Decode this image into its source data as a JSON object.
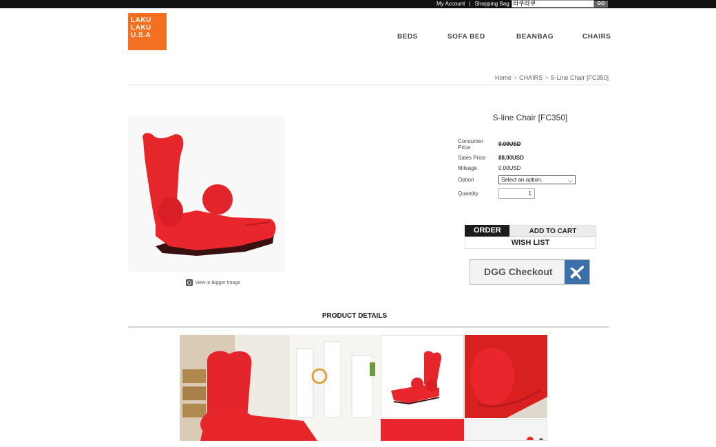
{
  "topbar": {
    "my_account": "My Account",
    "separator": "|",
    "shopping_bag": "Shopping Bag",
    "search_value": "라쿠라쿠",
    "go": "GO"
  },
  "logo": {
    "lines": [
      "LAKU",
      "LAKU",
      "U.S.A"
    ]
  },
  "nav": {
    "items": [
      "BEDS",
      "SOFA BED",
      "BEANBAG",
      "CHAIRS"
    ]
  },
  "breadcrumb": {
    "items": [
      "Home",
      "CHAIRS",
      "S-Line Chair [FC350]"
    ]
  },
  "product": {
    "title": "S-line Chair [FC350]",
    "consumer_price_label": "Consumer Price",
    "consumer_price": "0.00USD",
    "sales_price_label": "Sales Price",
    "sales_price": "88,00USD",
    "mileage_label": "Mileage",
    "mileage": "0,00USD",
    "option_label": "Option",
    "option_placeholder": "Select an option.",
    "quantity_label": "Quantity",
    "quantity": "1",
    "view_bigger": "View in Bigger Image"
  },
  "buttons": {
    "order": "ORDER",
    "add_to_cart": "ADD TO CART",
    "wish_list": "WISH LIST",
    "dgg_checkout": "DGG Checkout"
  },
  "details": {
    "title": "PRODUCT DETAILS"
  },
  "colors": {
    "brand": "#f36f21",
    "topbar": "#111111",
    "product": "#e8262c",
    "dgg_blue": "#3d6fa8"
  }
}
